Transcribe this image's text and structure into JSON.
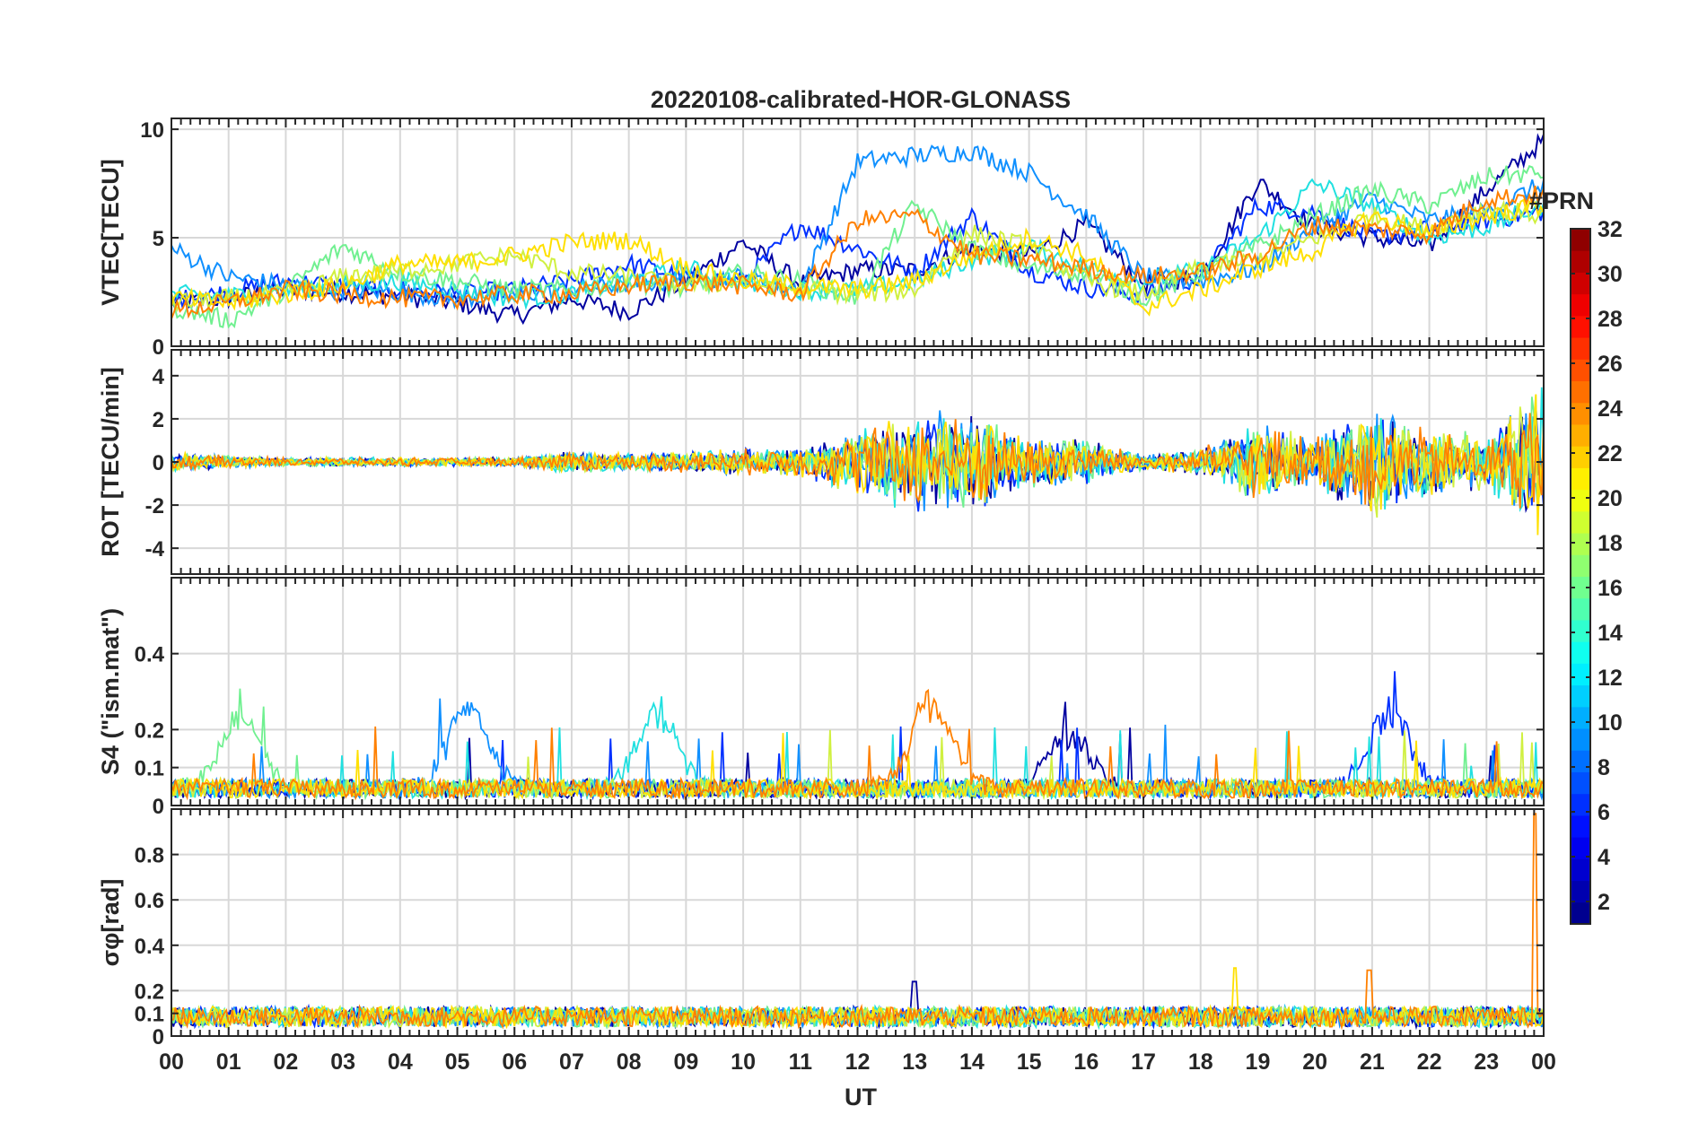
{
  "figure": {
    "title": "20220108-calibrated-HOR-GLONASS",
    "xlabel": "UT",
    "x_tick_labels": [
      "00",
      "01",
      "02",
      "03",
      "04",
      "05",
      "06",
      "07",
      "08",
      "09",
      "10",
      "11",
      "12",
      "13",
      "14",
      "15",
      "16",
      "17",
      "18",
      "19",
      "20",
      "21",
      "22",
      "23",
      "00"
    ]
  },
  "colorbar": {
    "label": "#PRN",
    "tick_labels": [
      "2",
      "4",
      "6",
      "8",
      "10",
      "12",
      "14",
      "16",
      "18",
      "20",
      "22",
      "24",
      "26",
      "28",
      "30",
      "32"
    ],
    "ticks": [
      2,
      4,
      6,
      8,
      10,
      12,
      14,
      16,
      18,
      20,
      22,
      24,
      26,
      28,
      30,
      32
    ],
    "range": [
      1,
      32
    ],
    "colormap": "jet",
    "levels": 32
  },
  "chart_data": [
    {
      "type": "line",
      "ylabel": "VTEC[TECU]",
      "xlim": [
        0,
        24
      ],
      "ylim": [
        0,
        10.5
      ],
      "y_tick_labels": [
        "0",
        "5",
        "10"
      ],
      "y_ticks": [
        0,
        5,
        10
      ],
      "grid": true,
      "series": [
        {
          "prn": 2,
          "color": "#0000A0",
          "x": [
            0,
            1,
            2,
            3,
            4,
            5,
            6,
            7,
            8,
            9,
            10,
            11,
            12,
            13,
            14,
            15,
            16,
            17,
            18,
            19,
            20,
            21,
            22,
            23,
            24
          ],
          "y": [
            2.0,
            2.2,
            2.6,
            2.5,
            2.3,
            2.0,
            1.4,
            2.2,
            1.6,
            3.0,
            4.8,
            2.9,
            3.5,
            3.5,
            4.5,
            4.2,
            5.6,
            2.9,
            3.2,
            7.6,
            5.5,
            5.0,
            4.6,
            7.2,
            9.5
          ]
        },
        {
          "prn": 5,
          "color": "#0030FF",
          "x": [
            0,
            1,
            2,
            3,
            4,
            5,
            6,
            7,
            8,
            9,
            10,
            11,
            12,
            13,
            14,
            15,
            16,
            17,
            18,
            19,
            20,
            21,
            22,
            23,
            24
          ],
          "y": [
            2.1,
            2.5,
            3.0,
            2.8,
            2.6,
            2.4,
            2.6,
            3.0,
            3.8,
            3.2,
            3.0,
            5.6,
            4.5,
            3.4,
            6.0,
            3.5,
            2.7,
            2.4,
            3.2,
            6.5,
            6.2,
            5.0,
            5.4,
            5.8,
            6.2
          ]
        },
        {
          "prn": 9,
          "color": "#1090FF",
          "x": [
            0,
            1,
            2,
            3,
            4,
            5,
            6,
            7,
            8,
            9,
            10,
            11,
            12,
            13,
            14,
            15,
            16,
            17,
            18,
            19,
            20,
            21,
            22,
            23,
            24
          ],
          "y": [
            4.5,
            3.2,
            2.8,
            2.6,
            2.5,
            2.2,
            2.4,
            2.6,
            2.9,
            3.0,
            3.2,
            2.6,
            8.5,
            8.8,
            9.0,
            8.0,
            6.0,
            3.2,
            3.0,
            3.6,
            5.5,
            6.8,
            5.8,
            6.2,
            7.5
          ]
        },
        {
          "prn": 13,
          "color": "#20E0E0",
          "x": [
            0,
            1,
            2,
            3,
            4,
            5,
            6,
            7,
            8,
            9,
            10,
            11,
            12,
            13,
            14,
            15,
            16,
            17,
            18,
            19,
            20,
            21,
            22,
            23,
            24
          ],
          "y": [
            2.4,
            2.3,
            2.6,
            2.8,
            3.0,
            2.6,
            2.2,
            2.4,
            3.0,
            3.6,
            2.9,
            2.6,
            2.6,
            3.0,
            4.0,
            4.6,
            3.6,
            3.0,
            3.5,
            5.0,
            7.5,
            6.5,
            5.0,
            5.5,
            6.5
          ]
        },
        {
          "prn": 16,
          "color": "#70F090",
          "x": [
            0,
            1,
            2,
            3,
            4,
            5,
            6,
            7,
            8,
            9,
            10,
            11,
            12,
            13,
            14,
            15,
            16,
            17,
            18,
            19,
            20,
            21,
            22,
            23,
            24
          ],
          "y": [
            1.8,
            1.2,
            2.6,
            4.6,
            3.4,
            3.0,
            2.6,
            2.6,
            3.0,
            2.6,
            3.4,
            3.0,
            2.2,
            6.5,
            4.5,
            3.6,
            3.4,
            2.2,
            3.4,
            4.6,
            6.0,
            7.2,
            6.5,
            7.8,
            8.0
          ]
        },
        {
          "prn": 18,
          "color": "#D0F040",
          "x": [
            0,
            1,
            2,
            3,
            4,
            5,
            6,
            7,
            8,
            9,
            10,
            11,
            12,
            13,
            14,
            15,
            16,
            17,
            18,
            19,
            20,
            21,
            22,
            23,
            24
          ],
          "y": [
            2.0,
            2.2,
            2.4,
            3.2,
            3.5,
            3.8,
            4.2,
            3.4,
            3.2,
            2.8,
            3.0,
            2.6,
            2.4,
            2.6,
            5.2,
            4.6,
            3.0,
            2.4,
            3.6,
            4.0,
            5.0,
            6.0,
            5.4,
            6.4,
            6.0
          ]
        },
        {
          "prn": 20,
          "color": "#FFE000",
          "x": [
            0,
            1,
            2,
            3,
            4,
            5,
            6,
            7,
            8,
            9,
            10,
            11,
            12,
            13,
            14,
            15,
            16,
            17,
            18,
            19,
            20,
            21,
            22,
            23,
            24
          ],
          "y": [
            2.2,
            2.0,
            2.4,
            2.8,
            3.8,
            3.8,
            4.2,
            4.8,
            4.9,
            3.6,
            3.0,
            2.8,
            2.6,
            3.0,
            4.2,
            5.0,
            4.2,
            1.8,
            2.6,
            3.6,
            4.4,
            6.0,
            5.2,
            6.0,
            6.5
          ]
        },
        {
          "prn": 24,
          "color": "#FF8000",
          "x": [
            0,
            1,
            2,
            3,
            4,
            5,
            6,
            7,
            8,
            9,
            10,
            11,
            12,
            13,
            14,
            15,
            16,
            17,
            18,
            19,
            20,
            21,
            22,
            23,
            24
          ],
          "y": [
            1.6,
            2.0,
            2.6,
            2.4,
            2.2,
            2.2,
            2.4,
            2.4,
            2.8,
            3.0,
            2.8,
            2.4,
            5.8,
            6.0,
            4.2,
            4.0,
            3.6,
            3.2,
            3.4,
            4.2,
            5.6,
            5.4,
            5.2,
            6.8,
            7.0
          ]
        }
      ]
    },
    {
      "type": "line",
      "ylabel": "ROT [TECU/min]",
      "xlim": [
        0,
        24
      ],
      "ylim": [
        -5.2,
        5.2
      ],
      "y_tick_labels": [
        "-4",
        "-2",
        "0",
        "2",
        "4"
      ],
      "y_ticks": [
        -4,
        -2,
        0,
        2,
        4
      ],
      "grid": true,
      "envelope": {
        "description_hours": [
          0,
          1,
          2,
          3,
          4,
          5,
          6,
          7,
          8,
          9,
          10,
          11,
          12,
          13,
          14,
          15,
          16,
          17,
          18,
          19,
          20,
          21,
          22,
          23,
          24
        ],
        "amplitude": [
          0.4,
          0.3,
          0.2,
          0.2,
          0.2,
          0.2,
          0.2,
          0.5,
          0.4,
          0.5,
          0.6,
          0.7,
          1.5,
          2.2,
          2.2,
          1.2,
          1.0,
          0.4,
          0.6,
          1.8,
          1.2,
          2.5,
          1.5,
          1.2,
          3.5
        ]
      }
    },
    {
      "type": "line",
      "ylabel": "S4 (\"ism.mat\")",
      "xlim": [
        0,
        24
      ],
      "ylim": [
        0,
        0.6
      ],
      "y_tick_labels": [
        "0",
        "0.1",
        "0.2",
        "0.4"
      ],
      "y_ticks": [
        0,
        0.1,
        0.2,
        0.4
      ],
      "grid": true,
      "peaks": [
        {
          "prn": 9,
          "color": "#1090FF",
          "x": 5.2,
          "y": 0.23
        },
        {
          "prn": 24,
          "color": "#FF8000",
          "x": 13.3,
          "y": 0.25
        },
        {
          "prn": 5,
          "color": "#0030FF",
          "x": 21.3,
          "y": 0.22
        },
        {
          "prn": 2,
          "color": "#0000A0",
          "x": 15.7,
          "y": 0.16
        },
        {
          "prn": 13,
          "color": "#20E0E0",
          "x": 8.5,
          "y": 0.22
        },
        {
          "prn": 16,
          "color": "#70F090",
          "x": 1.2,
          "y": 0.2
        }
      ]
    },
    {
      "type": "line",
      "ylabel": "σφ[rad]",
      "xlim": [
        0,
        24
      ],
      "ylim": [
        0,
        1.0
      ],
      "y_tick_labels": [
        "0",
        "0.1",
        "0.2",
        "0.4",
        "0.6",
        "0.8"
      ],
      "y_ticks": [
        0,
        0.1,
        0.2,
        0.4,
        0.6,
        0.8
      ],
      "grid": true,
      "spikes": [
        {
          "color": "#FF8000",
          "x": 23.85,
          "y": 0.98
        },
        {
          "color": "#FFE000",
          "x": 18.6,
          "y": 0.3
        },
        {
          "color": "#FF8000",
          "x": 20.95,
          "y": 0.29
        },
        {
          "color": "#0000A0",
          "x": 13.0,
          "y": 0.24
        }
      ]
    }
  ]
}
